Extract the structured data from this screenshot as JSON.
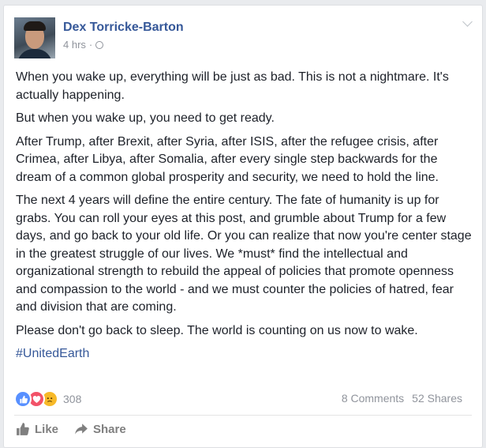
{
  "post": {
    "author": "Dex Torricke-Barton",
    "timestamp": "4 hrs",
    "separator": "·",
    "paragraphs": [
      "When you wake up, everything will be just as bad. This is not a nightmare. It's actually happening.",
      "But when you wake up, you need to get ready.",
      "After Trump, after Brexit, after Syria, after ISIS, after the refugee crisis, after Crimea, after Libya, after Somalia, after every single step backwards for the dream of a common global prosperity and security, we need to hold the line.",
      "The next 4 years will define the entire century. The fate of humanity is up for grabs. You can roll your eyes at this post, and grumble about Trump for a few days, and go back to your old life. Or you can realize that now you're center stage in the greatest struggle of our lives. We *must* find the intellectual and organizational strength to rebuild the appeal of policies that promote openness and compassion to the world - and we must counter the policies of hatred, fear and division that are coming.",
      "Please don't go back to sleep. The world is counting on us now to wake."
    ],
    "hashtag": "#UnitedEarth"
  },
  "reactions": {
    "count": "308",
    "icons": [
      "like-reaction-icon",
      "love-reaction-icon",
      "sad-reaction-icon"
    ]
  },
  "stats": {
    "comments": "8 Comments",
    "shares": "52 Shares"
  },
  "actions": {
    "like_label": "Like",
    "share_label": "Share"
  },
  "colors": {
    "link": "#365899",
    "text": "#1d2129",
    "muted": "#90949c",
    "like": "#5890ff",
    "love": "#f25268",
    "sad": "#f7b928"
  }
}
